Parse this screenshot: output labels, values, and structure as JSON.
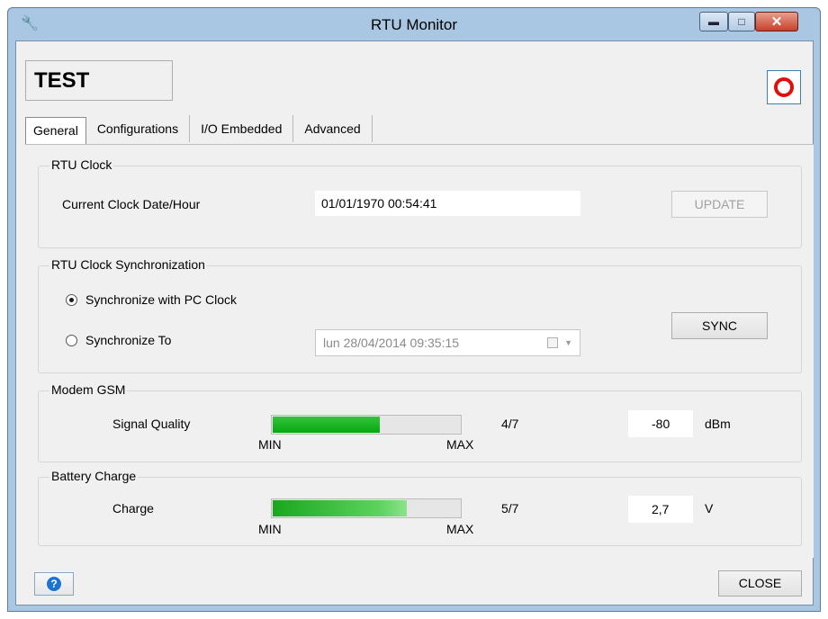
{
  "window": {
    "title": "RTU Monitor",
    "minimize_icon": "minimize-icon",
    "maximize_icon": "maximize-icon",
    "close_icon": "close-icon",
    "app_icon": "wrench-icon"
  },
  "header": {
    "device_name": "TEST",
    "stop_icon": "stop-record-icon",
    "stop_color": "#e01010"
  },
  "tabs": [
    {
      "label": "General",
      "active": true
    },
    {
      "label": "Configurations",
      "active": false
    },
    {
      "label": "I/O Embedded",
      "active": false
    },
    {
      "label": "Advanced",
      "active": false
    }
  ],
  "rtu_clock": {
    "title": "RTU Clock",
    "label": "Current Clock Date/Hour",
    "value": "01/01/1970 00:54:41",
    "update_button": "UPDATE",
    "update_enabled": false
  },
  "sync": {
    "title": "RTU Clock Synchronization",
    "option_pc": "Synchronize with PC Clock",
    "option_to": "Synchronize To",
    "selected": "pc",
    "date_value": "lun  28/04/2014 09:35:15",
    "sync_button": "SYNC"
  },
  "modem": {
    "title": "Modem GSM",
    "label": "Signal Quality",
    "level": 4,
    "level_max": 7,
    "level_text": "4/7",
    "min_label": "MIN",
    "max_label": "MAX",
    "value": "-80",
    "unit": "dBm",
    "bar_color": "#0aa814"
  },
  "battery": {
    "title": "Battery Charge",
    "label": "Charge",
    "level": 5,
    "level_max": 7,
    "level_text": "5/7",
    "min_label": "MIN",
    "max_label": "MAX",
    "value": "2,7",
    "unit": "V",
    "bar_color": "#1aa61f"
  },
  "footer": {
    "help_icon": "help-icon",
    "help_glyph": "?",
    "close_button": "CLOSE"
  }
}
